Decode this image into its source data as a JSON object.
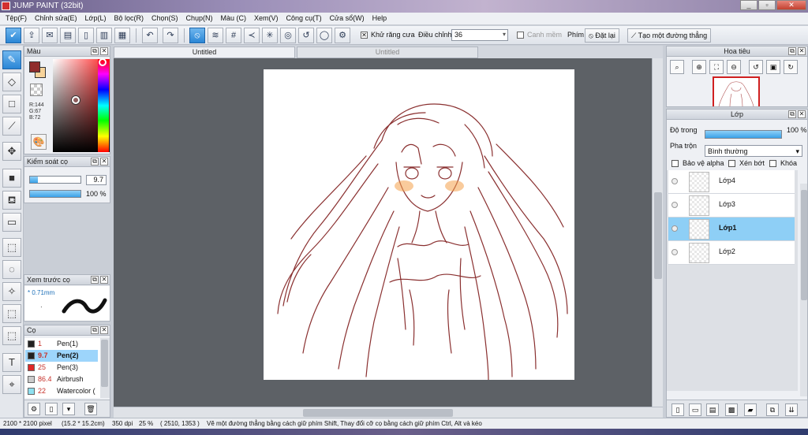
{
  "window": {
    "title": "JUMP PAINT (32bit)",
    "min": "_",
    "max": "▫",
    "close": "✕"
  },
  "menu": [
    "Tệp(F)",
    "Chỉnh sửa(E)",
    "Lớp(L)",
    "Bộ lọc(R)",
    "Chọn(S)",
    "Chụp(N)",
    "Màu (C)",
    "Xem(V)",
    "Công cụ(T)",
    "Cửa sổ(W)",
    "Help"
  ],
  "toolbar": {
    "antialias_label": "Khử răng cưa",
    "adjust_label": "Điều chỉnh",
    "adjust_value": "36",
    "smooth_label": "Canh mềm",
    "pen_label": "Phím",
    "reset_label": "Đặt lại",
    "line_label": "Tạo một đường thẳng"
  },
  "color_panel": {
    "title": "Màu",
    "r": "R:144",
    "g": "G:67",
    "b": "B:72",
    "fg": "#902c2c",
    "bg": "#f7d39a"
  },
  "brush_control": {
    "title": "Kiểm soát cọ",
    "size": "9.7",
    "opacity": "100 %",
    "size_fraction": 0.15,
    "opacity_fraction": 1.0
  },
  "brush_preview": {
    "title": "Xem trước cọ",
    "size_label": "* 0.71mm",
    "dot": "·"
  },
  "brush_list": {
    "title": "Cọ",
    "items": [
      {
        "num": "1",
        "name": "Pen(1)",
        "color": "#222222",
        "selected": false
      },
      {
        "num": "9.7",
        "name": "Pen(2)",
        "color": "#222222",
        "selected": true
      },
      {
        "num": "25",
        "name": "Pen(3)",
        "color": "#e02828",
        "selected": false
      },
      {
        "num": "86.4",
        "name": "Airbrush",
        "color": "#cccccc",
        "selected": false
      },
      {
        "num": "22",
        "name": "Watercolor (",
        "color": "#8ee0f0",
        "selected": false
      }
    ]
  },
  "tabs": [
    "Untitled",
    "Untitled"
  ],
  "navigator": {
    "title": "Hoa tiêu"
  },
  "layers": {
    "title": "Lớp",
    "opacity_label": "Độ trong",
    "opacity_value": "100 %",
    "blend_label": "Pha trộn",
    "blend_value": "Bình thường",
    "protect_alpha": "Bảo vệ alpha",
    "clip": "Xén bớt",
    "lock": "Khóa",
    "items": [
      {
        "name": "Lớp4",
        "selected": false
      },
      {
        "name": "Lớp3",
        "selected": false
      },
      {
        "name": "Lớp1",
        "selected": true
      },
      {
        "name": "Lớp2",
        "selected": false
      }
    ]
  },
  "status": {
    "size": "2100 * 2100 pixel",
    "cm": "(15.2 * 15.2cm)",
    "dpi": "350 dpi",
    "zoom": "25 %",
    "coords": "( 2510, 1353 )",
    "hint": "Vẽ một đường thẳng bằng cách giữ phím Shift, Thay đổi cỡ cọ bằng cách giữ phím Ctrl, Alt và kéo"
  }
}
